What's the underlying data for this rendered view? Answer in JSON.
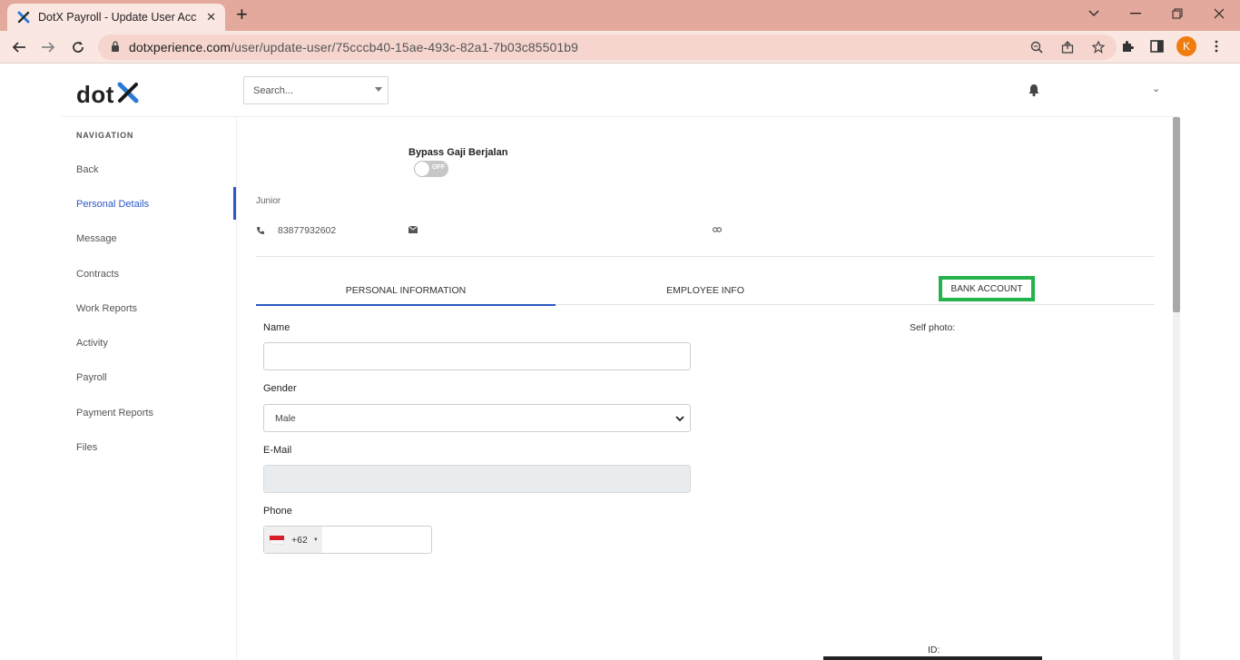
{
  "browser": {
    "tab_title": "DotX Payroll - Update User Account",
    "tab_close": "✕",
    "new_tab": "+",
    "url_host": "dotxperience.com",
    "url_path": "/user/update-user/75cccb40-15ae-493c-82a1-7b03c85501b9",
    "profile_initial": "K"
  },
  "header": {
    "logo_text": "dot",
    "search_placeholder": "Search...",
    "user_caret": "⌄"
  },
  "sidebar": {
    "title": "NAVIGATION",
    "items": [
      {
        "label": "Back"
      },
      {
        "label": "Personal Details"
      },
      {
        "label": "Message"
      },
      {
        "label": "Contracts"
      },
      {
        "label": "Work Reports"
      },
      {
        "label": "Activity"
      },
      {
        "label": "Payroll"
      },
      {
        "label": "Payment Reports"
      },
      {
        "label": "Files"
      }
    ]
  },
  "profile": {
    "bypass_label": "Bypass Gaji Berjalan",
    "toggle_state": "OFF",
    "role": "Junior",
    "phone": "83877932602"
  },
  "tabs": {
    "personal": "PERSONAL INFORMATION",
    "employee": "EMPLOYEE INFO",
    "bank": "BANK ACCOUNT"
  },
  "form": {
    "name_label": "Name",
    "name_value": "",
    "gender_label": "Gender",
    "gender_value": "Male",
    "email_label": "E-Mail",
    "email_value": "",
    "phone_label": "Phone",
    "phone_code": "+62",
    "phone_value": ""
  },
  "side_panel": {
    "self_photo_label": "Self photo:",
    "id_label": "ID:"
  },
  "colors": {
    "accent": "#2b59c3",
    "highlight": "#24b24b",
    "chrome": "#e3a99c"
  }
}
